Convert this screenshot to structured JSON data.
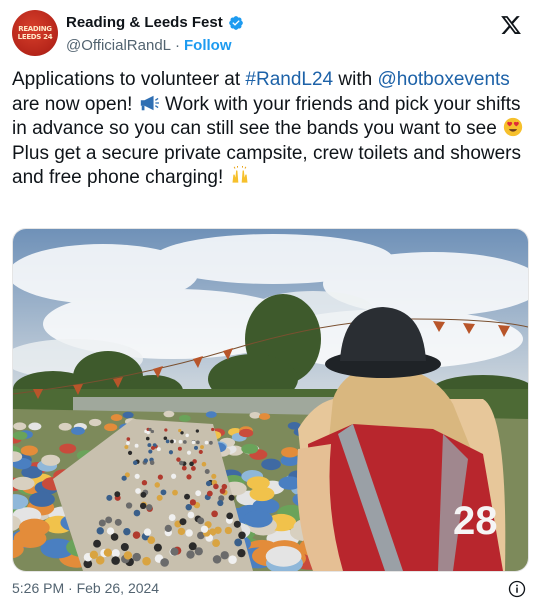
{
  "author": {
    "display_name": "Reading & Leeds Fest",
    "handle": "@OfficialRandL",
    "separator": "·",
    "follow_label": "Follow",
    "avatar_text": [
      "READING",
      "LEEDS 24"
    ]
  },
  "tweet": {
    "text_1": "Applications to volunteer at ",
    "hashtag": "#RandL24",
    "text_2": " with",
    "mention": "@hotboxevents",
    "text_3": " are now open! ",
    "text_4": " Work with your friends and pick your shifts in advance so you can still see the bands you want to see ",
    "text_5": " Plus get a secure private campsite, crew toilets and showers and free phone charging! ",
    "emojis": [
      "megaphone-icon",
      "heart-eyes-icon",
      "raised-hands-icon"
    ]
  },
  "photo": {
    "vest_number": "28"
  },
  "footer": {
    "timestamp": "5:26 PM · Feb 26, 2024"
  },
  "colors": {
    "link": "#1d62a8",
    "follow": "#1d9bf0",
    "secondary_text": "#536471",
    "verified": "#1d9bf0",
    "avatar": "#b5251a"
  }
}
